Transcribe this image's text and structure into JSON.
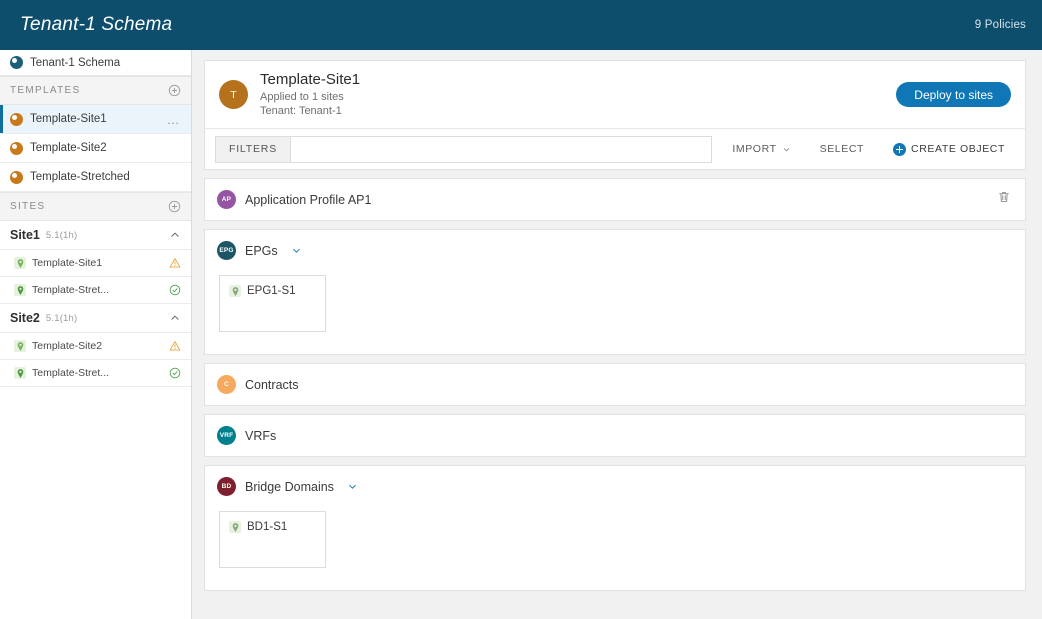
{
  "topbar": {
    "title": "Tenant-1 Schema",
    "policies_count": "9 Policies"
  },
  "sidebar": {
    "schema": {
      "label": "Tenant-1 Schema",
      "icon": "schema-icon"
    },
    "templates_section": {
      "label": "TEMPLATES",
      "add_icon": "plus-circle-icon"
    },
    "templates": [
      {
        "label": "Template-Site1",
        "selected": true,
        "menu": "…"
      },
      {
        "label": "Template-Site2",
        "selected": false
      },
      {
        "label": "Template-Stretched",
        "selected": false
      }
    ],
    "sites_section": {
      "label": "SITES",
      "add_icon": "plus-circle-icon"
    },
    "sites": [
      {
        "name": "Site1",
        "version": "5.1(1h)",
        "templates": [
          {
            "label": "Template-Site1",
            "status": "warning"
          },
          {
            "label": "Template-Stret...",
            "status": "ok"
          }
        ]
      },
      {
        "name": "Site2",
        "version": "5.1(1h)",
        "templates": [
          {
            "label": "Template-Site2",
            "status": "warning"
          },
          {
            "label": "Template-Stret...",
            "status": "ok"
          }
        ]
      }
    ]
  },
  "template_header": {
    "avatar_letter": "T",
    "title": "Template-Site1",
    "applied_to": "Applied to 1 sites",
    "tenant": "Tenant: Tenant-1",
    "deploy_label": "Deploy to sites"
  },
  "filters": {
    "label": "FILTERS",
    "value": "",
    "placeholder": "",
    "import_label": "IMPORT",
    "select_label": "SELECT",
    "create_object_label": "CREATE OBJECT"
  },
  "sections": [
    {
      "badge": "AP",
      "badge_color": "#9455a3",
      "label": "Application Profile AP1",
      "has_caret": false,
      "has_trash": true,
      "cards": []
    },
    {
      "badge": "EPG",
      "badge_color": "#1b5566",
      "label": "EPGs",
      "has_caret": true,
      "has_trash": false,
      "cards": [
        {
          "name": "EPG1-S1"
        }
      ]
    },
    {
      "badge": "C",
      "badge_color": "#f5aa5f",
      "label": "Contracts",
      "has_caret": false,
      "has_trash": false,
      "cards": []
    },
    {
      "badge": "VRF",
      "badge_color": "#00808c",
      "label": "VRFs",
      "has_caret": false,
      "has_trash": false,
      "cards": []
    },
    {
      "badge": "BD",
      "badge_color": "#7d1f2c",
      "label": "Bridge Domains",
      "has_caret": true,
      "has_trash": false,
      "cards": [
        {
          "name": "BD1-S1"
        }
      ]
    }
  ],
  "colors": {
    "topbar_bg": "#0d4e6c",
    "accent_blue": "#0f77b6",
    "selected_row": "#eaf4fa",
    "warning": "#f0ad33",
    "ok": "#4fa14f",
    "template_orange": "#c8791a"
  }
}
